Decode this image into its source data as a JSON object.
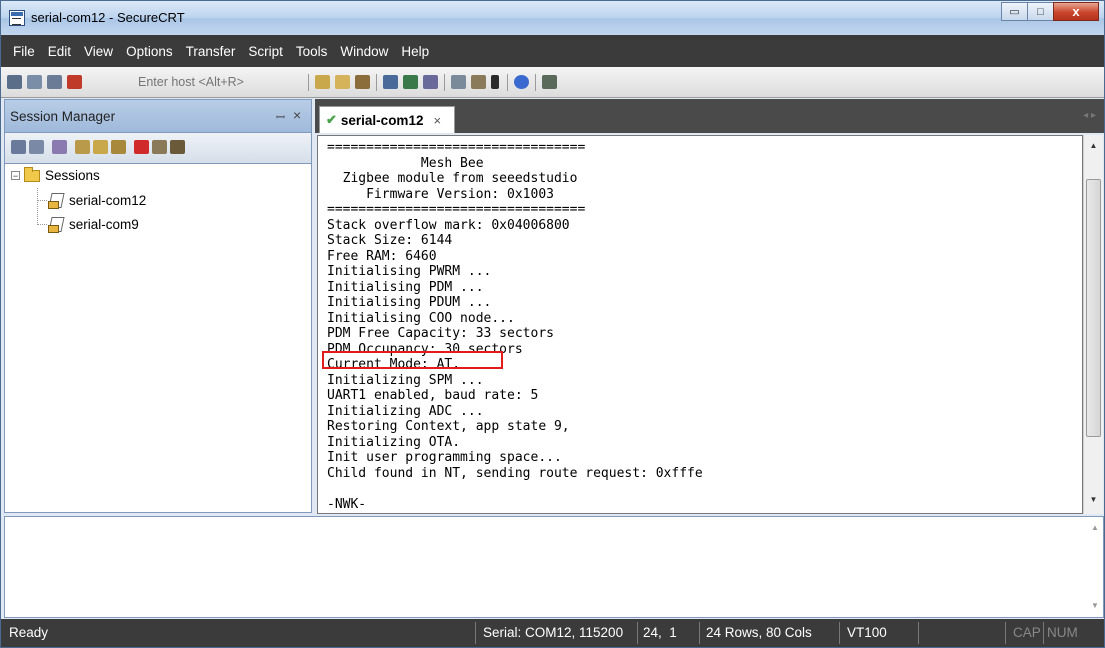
{
  "window": {
    "title": "serial-com12 - SecureCRT",
    "minimize_glyph": "▭",
    "maximize_glyph": "□",
    "close_glyph": "x"
  },
  "menu": [
    "File",
    "Edit",
    "View",
    "Options",
    "Transfer",
    "Script",
    "Tools",
    "Window",
    "Help"
  ],
  "toolbar": {
    "host_placeholder": "Enter host <Alt+R>"
  },
  "session_manager": {
    "title": "Session Manager",
    "pin_glyph": "ꟷ",
    "close_glyph": "×",
    "root": "Sessions",
    "sessions": [
      "serial-com12",
      "serial-com9"
    ]
  },
  "tab": {
    "label": "serial-com12",
    "close_glyph": "×",
    "nav_glyph": "◂ ▸"
  },
  "terminal": {
    "lines": [
      "=================================",
      "            Mesh Bee",
      "  Zigbee module from seeedstudio",
      "     Firmware Version: 0x1003",
      "=================================",
      "Stack overflow mark: 0x04006800",
      "Stack Size: 6144",
      "Free RAM: 6460",
      "Initialising PWRM ...",
      "Initialising PDM ...",
      "Initialising PDUM ...",
      "Initialising COO node...",
      "PDM Free Capacity: 33 sectors",
      "PDM Occupancy: 30 sectors",
      "Current Mode: AT.",
      "Initializing SPM ...",
      "UART1 enabled, baud rate: 5",
      "Initializing ADC ...",
      "Restoring Context, app state 9,",
      "Initializing OTA.",
      "Init user programming space...",
      "Child found in NT, sending route request: 0xfffe",
      "",
      "-NWK-"
    ],
    "highlighted_line": "Current Mode: AT."
  },
  "status": {
    "ready": "Ready",
    "connection": "Serial: COM12, 115200",
    "cursor": "24,  1",
    "size": "24 Rows, 80 Cols",
    "emulation": "VT100",
    "cap": "CAP",
    "num": "NUM"
  },
  "colors": {
    "highlight": "#e31b1b",
    "check": "#4aa34a"
  }
}
